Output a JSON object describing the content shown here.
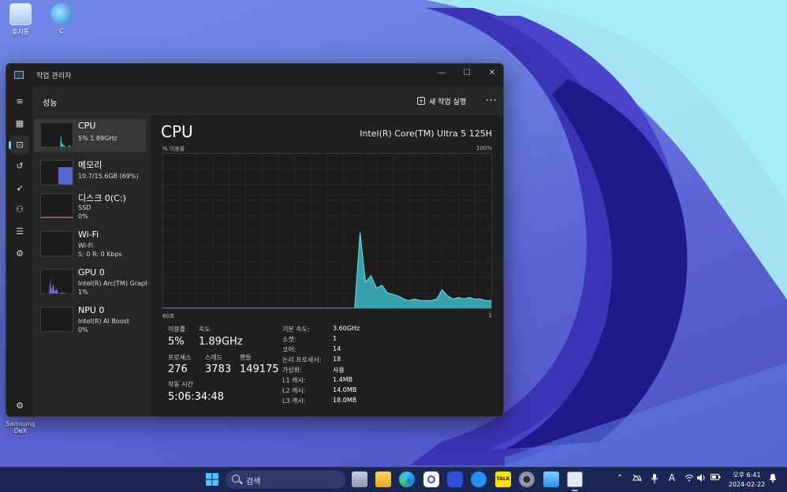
{
  "desktop": {
    "icons": [
      {
        "label": "휴지통",
        "icon": "recycle-bin-icon"
      },
      {
        "label": "C",
        "icon": "globe-icon"
      },
      {
        "label": "Samsung DeX",
        "icon": "samsung-dex-icon"
      }
    ]
  },
  "window": {
    "title": "작업 관리자",
    "controls": {
      "minimize": "—",
      "maximize": "☐",
      "close": "✕"
    }
  },
  "rail": {
    "items": [
      {
        "icon": "hamburger-menu-icon",
        "glyph": "≡"
      },
      {
        "icon": "processes-icon",
        "glyph": "▦"
      },
      {
        "icon": "performance-icon",
        "glyph": "⊡"
      },
      {
        "icon": "app-history-icon",
        "glyph": "↺"
      },
      {
        "icon": "startup-apps-icon",
        "glyph": "➶"
      },
      {
        "icon": "users-icon",
        "glyph": "⚇"
      },
      {
        "icon": "details-icon",
        "glyph": "☰"
      },
      {
        "icon": "services-icon",
        "glyph": "⚙"
      }
    ],
    "settings": {
      "icon": "settings-icon",
      "glyph": "⚙"
    }
  },
  "header": {
    "page_title": "성능",
    "run_new_task": "새 작업 실행",
    "more": "···"
  },
  "resources": [
    {
      "name": "CPU",
      "sub1": "5% 1.89GHz",
      "sub2": "",
      "utilization": 0.05
    },
    {
      "name": "메모리",
      "sub1": "10.7/15.6GB (69%)",
      "sub2": "",
      "utilization": 0.69
    },
    {
      "name": "디스크 0(C:)",
      "sub1": "SSD",
      "sub2": "0%",
      "utilization": 0.0
    },
    {
      "name": "Wi-Fi",
      "sub1": "Wi-Fi",
      "sub2": "S: 0 R: 0 Kbps",
      "utilization": 0.0
    },
    {
      "name": "GPU 0",
      "sub1": "Intel(R) Arc(TM) Graphics",
      "sub2": "1%",
      "utilization": 0.01
    },
    {
      "name": "NPU 0",
      "sub1": "Intel(R) AI Boost",
      "sub2": "0%",
      "utilization": 0.0
    }
  ],
  "detail": {
    "title": "CPU",
    "model": "Intel(R) Core(TM) Ultra 5 125H",
    "pct_label": "% 이용률",
    "pct_max": "100%",
    "axis_left": "60초",
    "axis_right": "1",
    "stats": {
      "util_label": "이용률",
      "util_value": "5%",
      "speed_label": "속도",
      "speed_value": "1.89GHz",
      "proc_label": "프로세스",
      "proc_value": "276",
      "thread_label": "스레드",
      "thread_value": "3783",
      "handle_label": "핸들",
      "handle_value": "149175",
      "uptime_label": "작동 시간",
      "uptime_value": "5:06:34:48"
    },
    "specs": [
      {
        "label": "기본 속도:",
        "value": "3.60GHz"
      },
      {
        "label": "소켓:",
        "value": "1"
      },
      {
        "label": "코어:",
        "value": "14"
      },
      {
        "label": "논리 프로세서:",
        "value": "18"
      },
      {
        "label": "가상화:",
        "value": "사용"
      },
      {
        "label": "L1 캐시:",
        "value": "1.4MB"
      },
      {
        "label": "L2 캐시:",
        "value": "14.0MB"
      },
      {
        "label": "L3 캐시:",
        "value": "18.0MB"
      }
    ]
  },
  "chart_data": {
    "type": "area",
    "x": [
      0,
      1,
      2,
      3,
      4,
      5,
      6,
      7,
      8,
      9,
      10,
      11,
      12,
      13,
      14,
      15,
      16,
      17,
      18,
      19,
      20,
      21,
      22,
      23,
      24,
      25,
      26,
      27,
      28,
      29,
      30,
      31,
      32,
      33,
      34,
      35,
      36,
      37,
      38,
      39,
      40,
      41,
      42,
      43,
      44,
      45,
      46,
      47,
      48,
      49,
      50,
      51,
      52,
      53,
      54,
      55,
      56,
      57,
      58,
      59,
      60
    ],
    "series": [
      {
        "values": [
          0,
          0,
          0,
          0,
          0,
          0,
          0,
          0,
          0,
          0,
          0,
          0,
          0,
          0,
          0,
          0,
          0,
          0,
          0,
          0,
          0,
          0,
          0,
          0,
          0,
          0,
          0,
          0,
          0,
          0,
          0,
          0,
          0,
          0,
          0,
          0,
          49,
          17,
          21,
          13,
          15,
          10,
          9,
          8,
          6,
          5,
          6,
          5,
          5,
          5,
          6,
          12,
          8,
          6,
          7,
          6,
          7,
          6,
          6,
          5,
          5
        ]
      }
    ],
    "ylim": [
      0,
      100
    ],
    "color": "#3cb8c8"
  },
  "taskbar": {
    "search_placeholder": "검색",
    "apps": [
      "windows-start-icon",
      "task-view-icon",
      "file-explorer-icon",
      "edge-icon",
      "bixby-icon",
      "camera-icon",
      "sync-icon",
      "kakaotalk-icon",
      "settings-gear-icon",
      "notepad-icon",
      "task-manager-icon"
    ],
    "kakao_label": "TALK",
    "tray": {
      "chevron": "⌃",
      "mic": "🎙",
      "ime": "A",
      "wifi": "wifi-icon",
      "volume": "volume-icon",
      "battery": "battery-icon"
    },
    "time": "오후 6:41",
    "date": "2024-02-22"
  },
  "colors": {
    "accent": "#60cdff",
    "cpu_graph": "#3cb8c8",
    "memory_graph": "#5566cc",
    "gpu_graph": "#7a5fcf"
  }
}
